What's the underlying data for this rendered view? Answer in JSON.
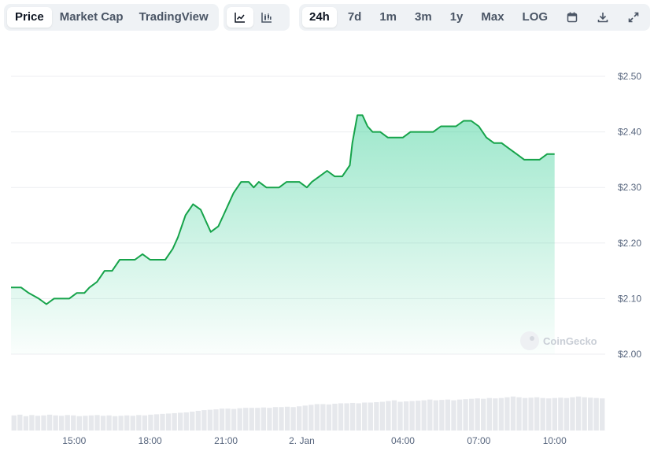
{
  "toolbar": {
    "metric_tabs": [
      "Price",
      "Market Cap",
      "TradingView"
    ],
    "active_metric": "Price",
    "chart_type_icons": [
      "line-chart-icon",
      "candlestick-chart-icon"
    ],
    "range_tabs": [
      "24h",
      "7d",
      "1m",
      "3m",
      "1y",
      "Max",
      "LOG"
    ],
    "active_range": "24h",
    "action_icons": [
      "calendar-icon",
      "download-icon",
      "expand-icon"
    ]
  },
  "watermark": "CoinGecko",
  "colors": {
    "line": "#16a34a",
    "fill": "#16c784",
    "grid": "#eceef1",
    "volume": "#e6e8ec"
  },
  "chart_data": {
    "type": "area",
    "title": "",
    "xlabel": "",
    "ylabel": "",
    "ylim": [
      2.0,
      2.5
    ],
    "grid": true,
    "y_ticks": [
      "$2.50",
      "$2.40",
      "$2.30",
      "$2.20",
      "$2.10",
      "$2.00"
    ],
    "y_tick_values": [
      2.5,
      2.4,
      2.3,
      2.2,
      2.1,
      2.0
    ],
    "x_range_hours": [
      12.5,
      36.0
    ],
    "x_ticks": [
      {
        "label": "15:00",
        "hour": 15
      },
      {
        "label": "18:00",
        "hour": 18
      },
      {
        "label": "21:00",
        "hour": 21
      },
      {
        "label": "2. Jan",
        "hour": 24
      },
      {
        "label": "04:00",
        "hour": 28
      },
      {
        "label": "07:00",
        "hour": 31
      },
      {
        "label": "10:00",
        "hour": 34
      }
    ],
    "series": [
      {
        "values": [
          [
            12.5,
            2.12
          ],
          [
            12.9,
            2.12
          ],
          [
            13.2,
            2.11
          ],
          [
            13.6,
            2.1
          ],
          [
            13.9,
            2.09
          ],
          [
            14.2,
            2.1
          ],
          [
            14.5,
            2.1
          ],
          [
            14.8,
            2.1
          ],
          [
            15.1,
            2.11
          ],
          [
            15.4,
            2.11
          ],
          [
            15.6,
            2.12
          ],
          [
            15.9,
            2.13
          ],
          [
            16.2,
            2.15
          ],
          [
            16.5,
            2.15
          ],
          [
            16.8,
            2.17
          ],
          [
            17.1,
            2.17
          ],
          [
            17.4,
            2.17
          ],
          [
            17.7,
            2.18
          ],
          [
            18.0,
            2.17
          ],
          [
            18.3,
            2.17
          ],
          [
            18.6,
            2.17
          ],
          [
            18.9,
            2.19
          ],
          [
            19.1,
            2.21
          ],
          [
            19.4,
            2.25
          ],
          [
            19.7,
            2.27
          ],
          [
            20.0,
            2.26
          ],
          [
            20.2,
            2.24
          ],
          [
            20.4,
            2.22
          ],
          [
            20.7,
            2.23
          ],
          [
            20.9,
            2.25
          ],
          [
            21.1,
            2.27
          ],
          [
            21.3,
            2.29
          ],
          [
            21.6,
            2.31
          ],
          [
            21.9,
            2.31
          ],
          [
            22.1,
            2.3
          ],
          [
            22.3,
            2.31
          ],
          [
            22.6,
            2.3
          ],
          [
            22.9,
            2.3
          ],
          [
            23.1,
            2.3
          ],
          [
            23.4,
            2.31
          ],
          [
            23.6,
            2.31
          ],
          [
            23.9,
            2.31
          ],
          [
            24.2,
            2.3
          ],
          [
            24.4,
            2.31
          ],
          [
            24.7,
            2.32
          ],
          [
            25.0,
            2.33
          ],
          [
            25.3,
            2.32
          ],
          [
            25.6,
            2.32
          ],
          [
            25.9,
            2.34
          ],
          [
            26.0,
            2.38
          ],
          [
            26.2,
            2.43
          ],
          [
            26.4,
            2.43
          ],
          [
            26.6,
            2.41
          ],
          [
            26.8,
            2.4
          ],
          [
            27.1,
            2.4
          ],
          [
            27.4,
            2.39
          ],
          [
            27.7,
            2.39
          ],
          [
            28.0,
            2.39
          ],
          [
            28.3,
            2.4
          ],
          [
            28.6,
            2.4
          ],
          [
            28.9,
            2.4
          ],
          [
            29.2,
            2.4
          ],
          [
            29.5,
            2.41
          ],
          [
            29.8,
            2.41
          ],
          [
            30.1,
            2.41
          ],
          [
            30.4,
            2.42
          ],
          [
            30.7,
            2.42
          ],
          [
            31.0,
            2.41
          ],
          [
            31.3,
            2.39
          ],
          [
            31.6,
            2.38
          ],
          [
            31.9,
            2.38
          ],
          [
            32.2,
            2.37
          ],
          [
            32.5,
            2.36
          ],
          [
            32.8,
            2.35
          ],
          [
            33.1,
            2.35
          ],
          [
            33.4,
            2.35
          ],
          [
            33.7,
            2.36
          ],
          [
            34.0,
            2.36
          ]
        ]
      }
    ],
    "volume_relative": [
      0.4,
      0.42,
      0.38,
      0.41,
      0.39,
      0.4,
      0.42,
      0.4,
      0.39,
      0.41,
      0.4,
      0.38,
      0.39,
      0.4,
      0.41,
      0.39,
      0.4,
      0.38,
      0.39,
      0.4,
      0.39,
      0.41,
      0.4,
      0.42,
      0.43,
      0.44,
      0.45,
      0.46,
      0.47,
      0.48,
      0.5,
      0.52,
      0.54,
      0.55,
      0.56,
      0.58,
      0.58,
      0.57,
      0.59,
      0.6,
      0.6,
      0.6,
      0.61,
      0.6,
      0.62,
      0.62,
      0.63,
      0.62,
      0.64,
      0.66,
      0.68,
      0.7,
      0.7,
      0.69,
      0.71,
      0.72,
      0.72,
      0.73,
      0.72,
      0.74,
      0.74,
      0.75,
      0.76,
      0.78,
      0.8,
      0.76,
      0.77,
      0.78,
      0.79,
      0.8,
      0.82,
      0.8,
      0.81,
      0.82,
      0.8,
      0.82,
      0.83,
      0.84,
      0.85,
      0.84,
      0.86,
      0.85,
      0.86,
      0.88,
      0.9,
      0.88,
      0.86,
      0.87,
      0.88,
      0.86,
      0.85,
      0.86,
      0.87,
      0.86,
      0.88,
      0.9,
      0.88,
      0.87,
      0.86,
      0.85
    ]
  }
}
